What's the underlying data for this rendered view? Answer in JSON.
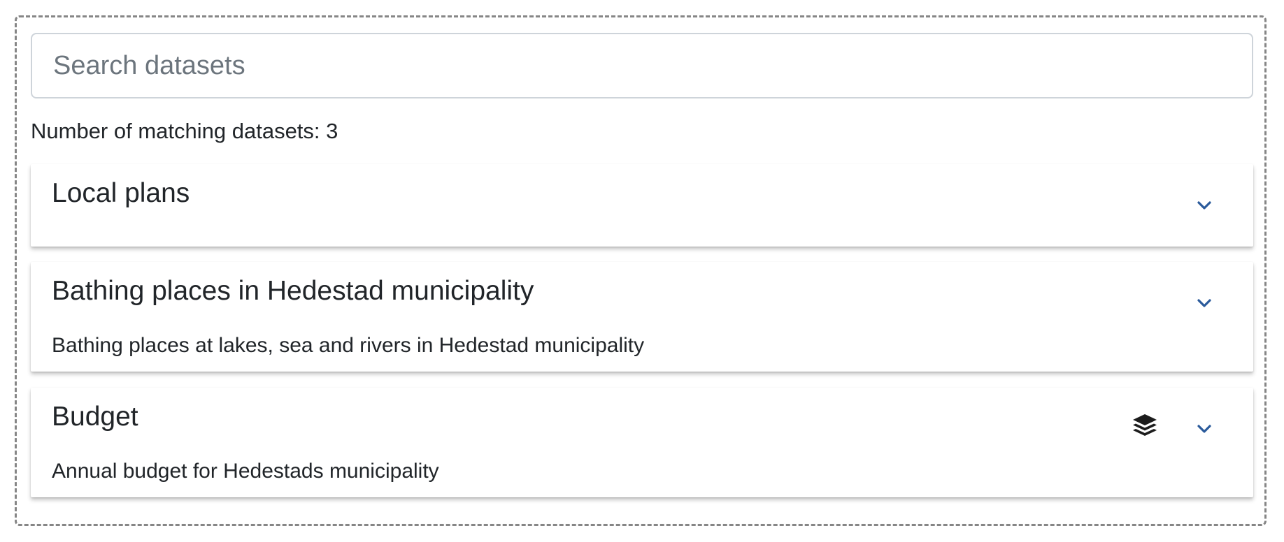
{
  "search": {
    "placeholder": "Search datasets",
    "value": ""
  },
  "results": {
    "count_text": "Number of matching datasets: 3"
  },
  "datasets": [
    {
      "title": "Local plans",
      "description": "",
      "has_layers_icon": false,
      "expand_icon": "chevron-down-icon"
    },
    {
      "title": "Bathing places in Hedestad municipality",
      "description": "Bathing places at lakes, sea and rivers in Hedestad municipality",
      "has_layers_icon": false,
      "expand_icon": "chevron-down-icon"
    },
    {
      "title": "Budget",
      "description": "Annual budget for Hedestads municipality",
      "has_layers_icon": true,
      "layers_icon": "layers-icon",
      "expand_icon": "chevron-down-icon"
    }
  ],
  "colors": {
    "chevron": "#2a5a9b",
    "border_dashed": "#868686",
    "text": "#212529"
  }
}
